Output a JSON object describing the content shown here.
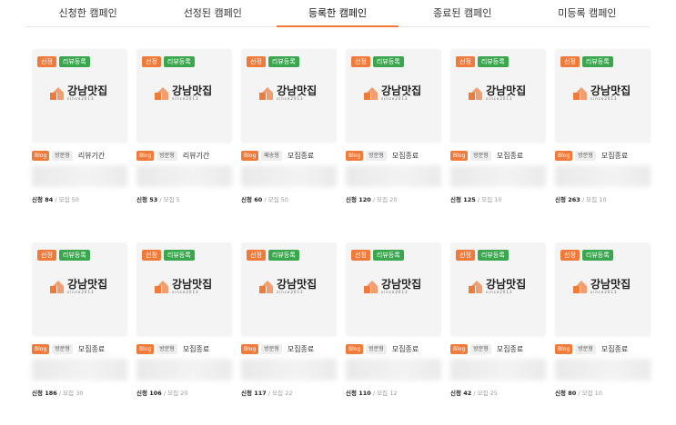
{
  "tabs": [
    {
      "label": "신청한 캠페인",
      "active": false
    },
    {
      "label": "선정된 캠페인",
      "active": false
    },
    {
      "label": "등록한 캠페인",
      "active": true
    },
    {
      "label": "종료된 캠페인",
      "active": false
    },
    {
      "label": "미등록 캠페인",
      "active": false
    }
  ],
  "colors": {
    "accent": "#f07a3a",
    "green": "#3aa74f"
  },
  "card_common": {
    "badge_selected": "선정",
    "badge_review": "리뷰등록",
    "logo_name": "강남맛집",
    "logo_since": "since2013",
    "tag_blog": "Blog",
    "request_prefix": "신청",
    "recruit_prefix": "모집"
  },
  "cards": [
    {
      "type": "방문형",
      "status": "리뷰기간",
      "requests": "84",
      "recruits": "50"
    },
    {
      "type": "방문형",
      "status": "리뷰기간",
      "requests": "53",
      "recruits": "5"
    },
    {
      "type": "배송형",
      "status": "모집종료",
      "requests": "60",
      "recruits": "50"
    },
    {
      "type": "방문형",
      "status": "모집종료",
      "requests": "120",
      "recruits": "20"
    },
    {
      "type": "방문형",
      "status": "모집종료",
      "requests": "125",
      "recruits": "10"
    },
    {
      "type": "방문형",
      "status": "모집종료",
      "requests": "263",
      "recruits": "10"
    },
    {
      "type": "방문형",
      "status": "모집종료",
      "requests": "186",
      "recruits": "30"
    },
    {
      "type": "방문형",
      "status": "모집종료",
      "requests": "106",
      "recruits": "20"
    },
    {
      "type": "방문형",
      "status": "모집종료",
      "requests": "117",
      "recruits": "22"
    },
    {
      "type": "방문형",
      "status": "모집종료",
      "requests": "110",
      "recruits": "12"
    },
    {
      "type": "방문형",
      "status": "모집종료",
      "requests": "42",
      "recruits": "25"
    },
    {
      "type": "방문형",
      "status": "모집종료",
      "requests": "80",
      "recruits": "10"
    }
  ]
}
